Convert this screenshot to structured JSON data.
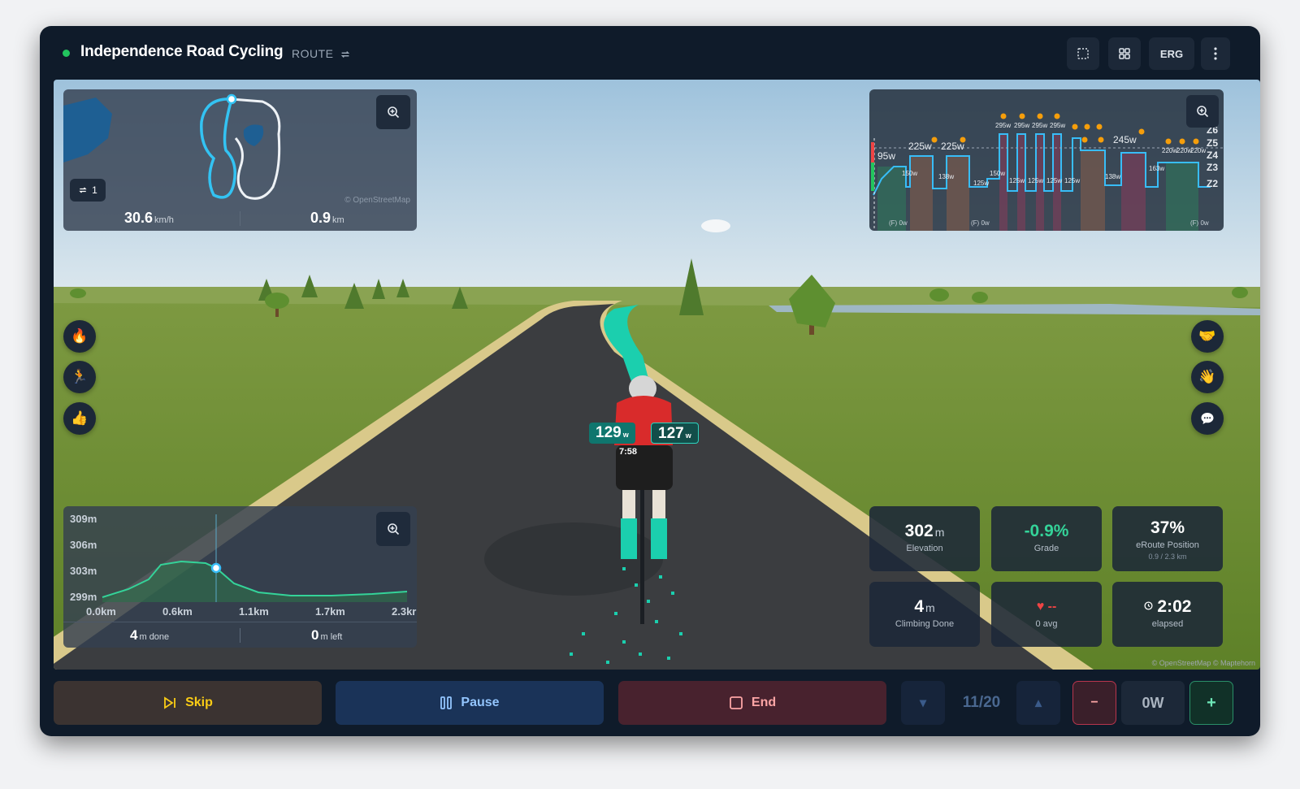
{
  "header": {
    "title": "Independence Road Cycling",
    "route_label": "ROUTE",
    "mode_button": "ERG",
    "status_color": "#22c55e"
  },
  "minimap": {
    "lap_count": "1",
    "attribution": "© OpenStreetMap",
    "speed_value": "30.6",
    "speed_unit": "km/h",
    "distance_value": "0.9",
    "distance_unit": "km"
  },
  "workout_chart": {
    "start_power": "95w",
    "zones": [
      "Z6",
      "Z5",
      "Z4",
      "Z3",
      "Z2"
    ],
    "interval_labels": [
      "225w",
      "225w",
      "295w",
      "295w",
      "295w",
      "295w",
      "245w",
      "220w",
      "220w",
      "220w",
      "150w",
      "138w",
      "125w",
      "150w",
      "125w",
      "125w",
      "125w",
      "125w",
      "138w",
      "150w",
      "163w",
      "138w",
      "0w"
    ],
    "footer_labels": [
      "(F) 0w",
      "(F) 0w",
      "(F) 0w"
    ]
  },
  "rider": {
    "power_left": "129",
    "power_right": "127",
    "power_unit": "w",
    "timer": "7:58"
  },
  "left_actions": [
    "flame-icon",
    "rider-icon",
    "thumbs-up-icon"
  ],
  "right_actions": [
    "handshake-icon",
    "wave-icon",
    "chat-icon"
  ],
  "elevation_profile": {
    "y_ticks": [
      "309m",
      "306m",
      "303m",
      "299m"
    ],
    "x_ticks": [
      "0.0km",
      "0.6km",
      "1.1km",
      "1.7km",
      "2.3kr"
    ],
    "done_value": "4",
    "done_label": "m done",
    "left_value": "0",
    "left_label": "m left"
  },
  "metrics": {
    "elevation_value": "302",
    "elevation_unit": "m",
    "elevation_label": "Elevation",
    "grade_value": "-0.9%",
    "grade_label": "Grade",
    "grade_color": "#34d399",
    "position_value": "37%",
    "position_label": "eRoute Position",
    "position_sub": "0.9 / 2.3 km",
    "climb_value": "4",
    "climb_unit": "m",
    "climb_label": "Climbing Done",
    "hr_value": "--",
    "hr_label": "0 avg",
    "elapsed_value": "2:02",
    "elapsed_label": "elapsed"
  },
  "map_attribution": "© OpenStreetMap © Maptehorn",
  "controls": {
    "skip_label": "Skip",
    "pause_label": "Pause",
    "end_label": "End",
    "interval_counter": "11/20",
    "power_target": "0W",
    "minus_label": "−",
    "plus_label": "+"
  }
}
